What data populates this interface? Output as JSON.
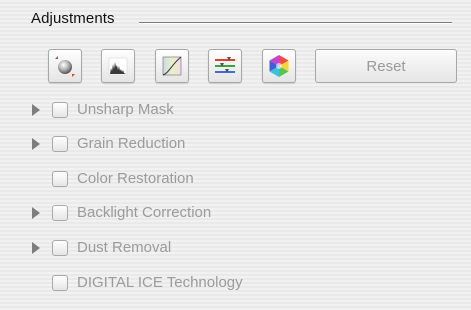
{
  "panel": {
    "title": "Adjustments"
  },
  "toolbar": {
    "tools": [
      {
        "icon": "image-adjust-icon"
      },
      {
        "icon": "histogram-icon"
      },
      {
        "icon": "tone-curve-icon"
      },
      {
        "icon": "color-balance-icon"
      },
      {
        "icon": "color-wheel-icon"
      }
    ],
    "reset_label": "Reset"
  },
  "adjustments": [
    {
      "label": "Unsharp Mask",
      "expandable": true,
      "checked": false
    },
    {
      "label": "Grain Reduction",
      "expandable": true,
      "checked": false
    },
    {
      "label": "Color Restoration",
      "expandable": false,
      "checked": false
    },
    {
      "label": "Backlight Correction",
      "expandable": true,
      "checked": false
    },
    {
      "label": "Dust Removal",
      "expandable": true,
      "checked": false
    },
    {
      "label": "DIGITAL ICE Technology",
      "expandable": false,
      "checked": false
    }
  ],
  "colors": {
    "label_disabled": "#9b9b9b",
    "title": "#111111",
    "panel_background": "#ececec"
  }
}
